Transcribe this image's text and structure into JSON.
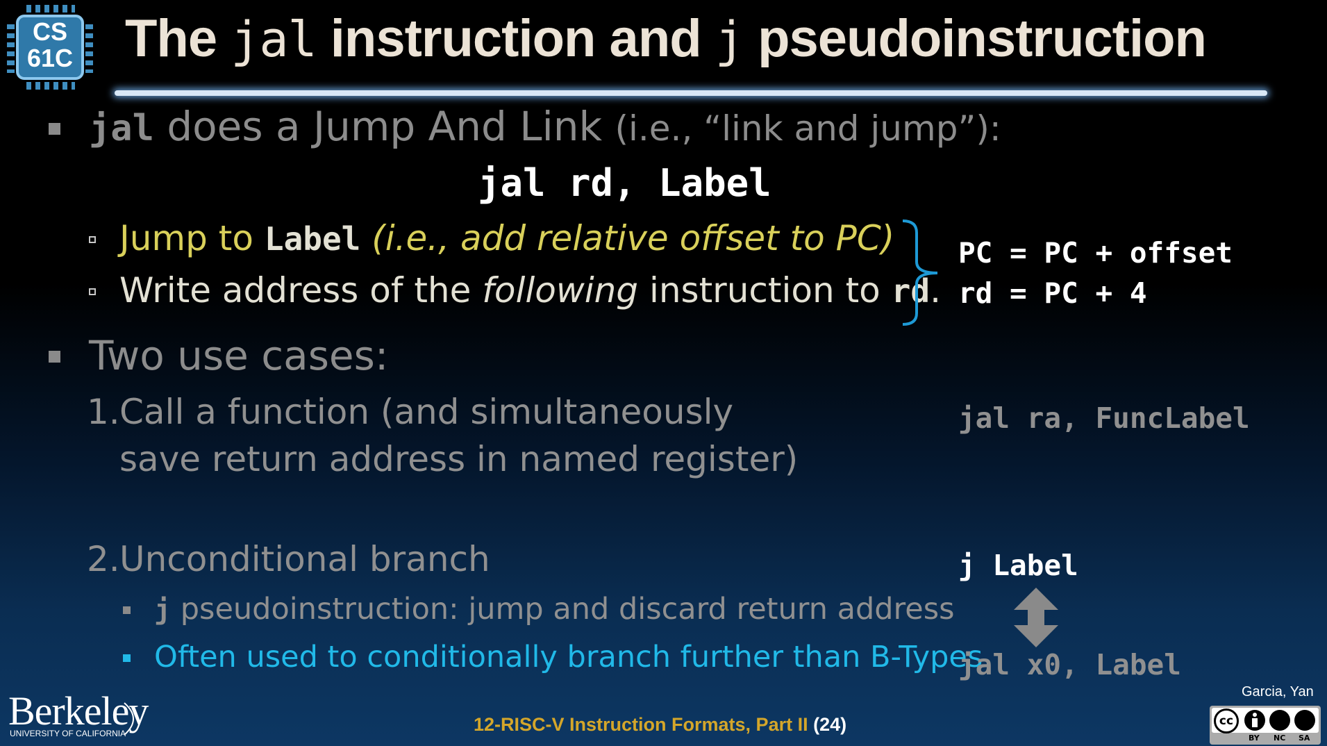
{
  "logo": {
    "line1": "CS",
    "line2": "61C"
  },
  "title": {
    "part1": "The ",
    "code1": "jal",
    "part2": " instruction and ",
    "code2": "j",
    "part3": " pseudoinstruction"
  },
  "bullet1": {
    "code": "jal",
    "text": " does a Jump And Link ",
    "paren": "(i.e., “link and jump”):",
    "syntax": "jal rd, Label"
  },
  "sub1": {
    "text1": "Jump to ",
    "code": "Label",
    "italic": " (i.e., add relative offset to PC)"
  },
  "sub2": {
    "text1": "Write address of the ",
    "italic": "following",
    "text2": " instruction to ",
    "code": "rd",
    "end": "."
  },
  "effects": {
    "line1": "PC = PC + offset",
    "line2": "rd = PC + 4"
  },
  "bullet2": {
    "text": "Two use cases:"
  },
  "case1": {
    "num": "1.",
    "line1": "Call a function (and simultaneously",
    "line2": "save return address in named register)",
    "code": "jal ra, FuncLabel"
  },
  "case2": {
    "num": "2.",
    "text": "Unconditional branch",
    "sub1_code": "j",
    "sub1_text": " pseudoinstruction: jump and discard return address",
    "sub2_text": "Often used to conditionally branch further than B-Types",
    "code_top": "j Label",
    "code_bottom": "jal x0, Label"
  },
  "footer": {
    "institution": "Berkeley",
    "institution_sub": "UNIVERSITY OF CALIFORNIA",
    "lecture": "12-RISC-V Instruction Formats, Part II",
    "slide": " (24)",
    "author": "Garcia, Yan",
    "license_labels": [
      "BY",
      "NC",
      "SA"
    ],
    "license_cc": "cc"
  },
  "colors": {
    "title": "#ece3d6",
    "yellow": "#d9d05a",
    "cyan": "#21b9e8",
    "gray": "#8c8c8c",
    "bracket": "#1e9ad6",
    "footer_gold": "#d4a62a"
  }
}
